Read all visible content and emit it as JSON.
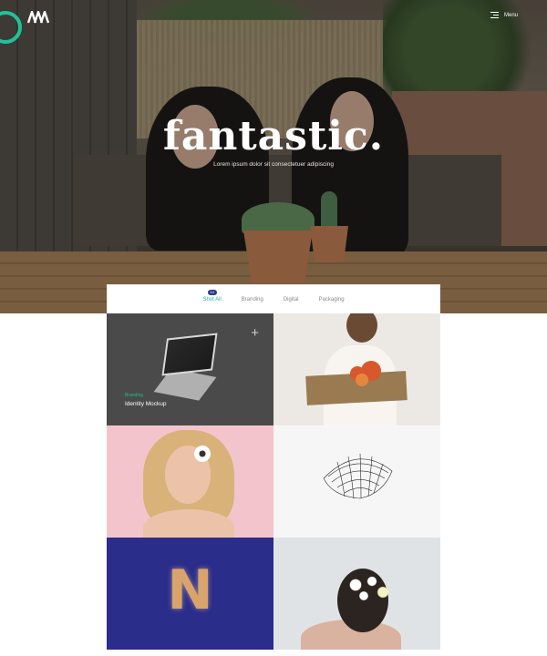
{
  "header": {
    "logo_icon": "brand-m-logo",
    "menu_label": "Menu",
    "menu_icon": "hamburger-icon",
    "accent_color": "#1fc29a"
  },
  "hero": {
    "title": "fantastic.",
    "subtitle": "Lorem ipsum dolor sit consectetuer adipiscing"
  },
  "filter": {
    "items": [
      {
        "label": "Shot All",
        "active": true,
        "badge": "14"
      },
      {
        "label": "Branding",
        "active": false
      },
      {
        "label": "Digital",
        "active": false
      },
      {
        "label": "Packaging",
        "active": false
      }
    ],
    "active_color": "#23b98c",
    "badge_color": "#2a3a8c"
  },
  "portfolio": {
    "tiles": [
      {
        "category": "Branding",
        "title": "Identity Mockup",
        "icon": "plus-icon",
        "background": "#4a4a4a"
      },
      {
        "background": "#ece9e5"
      },
      {
        "background": "#f4c4cd"
      },
      {
        "background": "#f6f6f6"
      },
      {
        "letter": "N",
        "background": "#2a2d8a"
      },
      {
        "background": "#dfe3e6"
      }
    ]
  }
}
